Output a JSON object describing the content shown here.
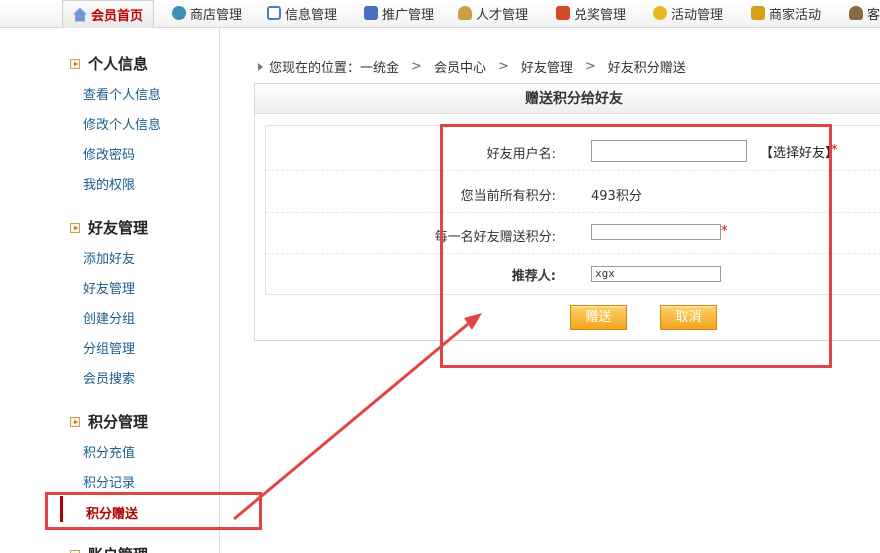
{
  "topnav": {
    "items": [
      {
        "label": "会员首页",
        "icon": "home-icon"
      },
      {
        "label": "商店管理",
        "icon": "money-bag-icon"
      },
      {
        "label": "信息管理",
        "icon": "document-icon"
      },
      {
        "label": "推广管理",
        "icon": "megaphone-icon"
      },
      {
        "label": "人才管理",
        "icon": "person-icon"
      },
      {
        "label": "兑奖管理",
        "icon": "gift-icon"
      },
      {
        "label": "活动管理",
        "icon": "coins-icon"
      },
      {
        "label": "商家活动",
        "icon": "coins-stack-icon"
      },
      {
        "label": "客",
        "icon": "person-key-icon"
      }
    ]
  },
  "sidebar": {
    "groups": [
      {
        "title": "个人信息",
        "items": [
          "查看个人信息",
          "修改个人信息",
          "修改密码",
          "我的权限"
        ]
      },
      {
        "title": "好友管理",
        "items": [
          "添加好友",
          "好友管理",
          "创建分组",
          "分组管理",
          "会员搜索"
        ]
      },
      {
        "title": "积分管理",
        "items": [
          "积分充值",
          "积分记录",
          "积分赠送"
        ]
      },
      {
        "title": "账户管理",
        "items": []
      }
    ]
  },
  "breadcrumb": {
    "prefix": "您现在的位置：",
    "parts": [
      "一统金",
      "会员中心",
      "好友管理",
      "好友积分赠送"
    ],
    "separator": ">"
  },
  "panel": {
    "title": "赠送积分给好友",
    "form": {
      "friend_label": "好友用户名:",
      "friend_value": "",
      "choose_friend": "【选择好友】",
      "current_points_label": "您当前所有积分:",
      "current_points_value": "493积分",
      "per_friend_label": "每一名好友赠送积分:",
      "per_friend_value": "",
      "referrer_label": "推荐人:",
      "referrer_value": "xgx",
      "required_mark": "*",
      "submit_label": "赠送",
      "cancel_label": "取消"
    }
  },
  "colors": {
    "annotation": "#e04444",
    "link": "#1a5e8c",
    "active": "#b00000",
    "button": "#f0a21c"
  }
}
